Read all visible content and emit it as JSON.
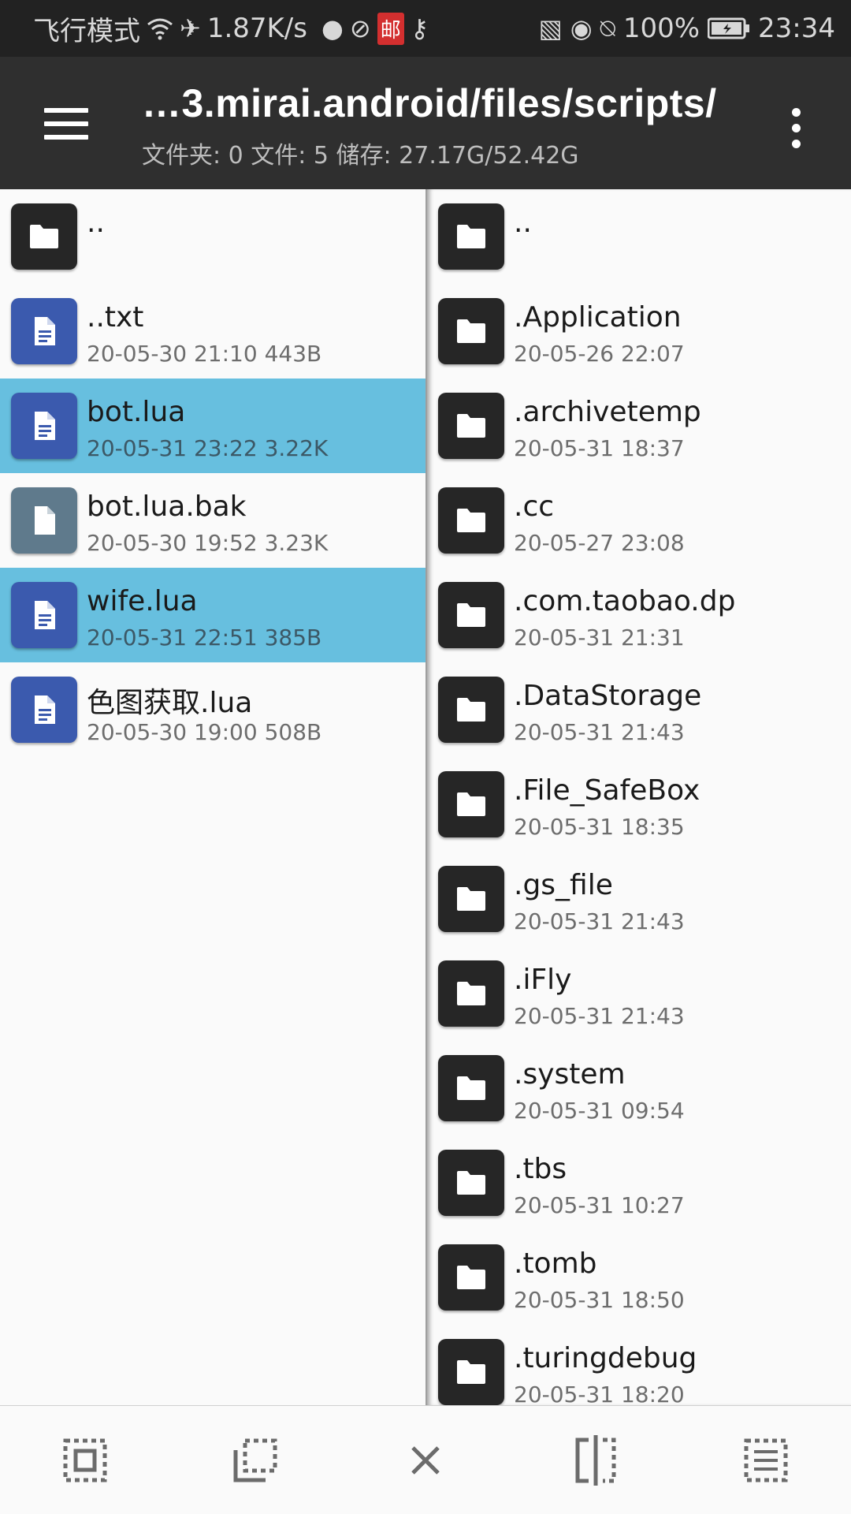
{
  "status_bar": {
    "left_text": "飞行模式",
    "net_speed": "1.87K/s",
    "mail_badge": "邮",
    "battery": "100%",
    "time": "23:34"
  },
  "app_bar": {
    "path": "…3.mirai.android/files/scripts/",
    "summary": "文件夹: 0  文件: 5  储存: 27.17G/52.42G"
  },
  "left_pane": {
    "items": [
      {
        "name": "..",
        "meta": "",
        "type": "folder",
        "selected": false
      },
      {
        "name": "..txt",
        "meta": "20-05-30 21:10  443B",
        "type": "doc",
        "selected": false
      },
      {
        "name": "bot.lua",
        "meta": "20-05-31 23:22  3.22K",
        "type": "doc",
        "selected": true
      },
      {
        "name": "bot.lua.bak",
        "meta": "20-05-30 19:52  3.23K",
        "type": "bak",
        "selected": false
      },
      {
        "name": "wife.lua",
        "meta": "20-05-31 22:51  385B",
        "type": "doc",
        "selected": true
      },
      {
        "name": "色图获取.lua",
        "meta": "20-05-30 19:00  508B",
        "type": "doc",
        "selected": false
      }
    ]
  },
  "right_pane": {
    "items": [
      {
        "name": "..",
        "meta": ""
      },
      {
        "name": ".Application",
        "meta": "20-05-26 22:07"
      },
      {
        "name": ".archivetemp",
        "meta": "20-05-31 18:37"
      },
      {
        "name": ".cc",
        "meta": "20-05-27 23:08"
      },
      {
        "name": ".com.taobao.dp",
        "meta": "20-05-31 21:31"
      },
      {
        "name": ".DataStorage",
        "meta": "20-05-31 21:43"
      },
      {
        "name": ".File_SafeBox",
        "meta": "20-05-31 18:35"
      },
      {
        "name": ".gs_file",
        "meta": "20-05-31 21:43"
      },
      {
        "name": ".iFly",
        "meta": "20-05-31 21:43"
      },
      {
        "name": ".system",
        "meta": "20-05-31 09:54"
      },
      {
        "name": ".tbs",
        "meta": "20-05-31 10:27"
      },
      {
        "name": ".tomb",
        "meta": "20-05-31 18:50"
      },
      {
        "name": ".turingdebug",
        "meta": "20-05-31 18:20"
      }
    ]
  },
  "toolbar": {
    "buttons": [
      "select-all-icon",
      "select-range-icon",
      "close-icon",
      "split-view-icon",
      "list-select-icon"
    ]
  },
  "colors": {
    "status_bar": "#222222",
    "app_bar": "#2f2f2f",
    "selected_row": "#67bfdf",
    "doc_icon": "#3b5aae",
    "folder_icon": "#262626",
    "bak_icon": "#5f7a8c"
  }
}
